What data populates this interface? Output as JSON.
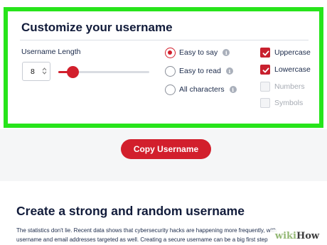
{
  "panel": {
    "title": "Customize your username",
    "length_label": "Username Length",
    "length_value": "8",
    "slider_level": 0.16
  },
  "radio_options": [
    {
      "label": "Easy to say",
      "checked": true
    },
    {
      "label": "Easy to read",
      "checked": false
    },
    {
      "label": "All characters",
      "checked": false
    }
  ],
  "checkbox_options": [
    {
      "label": "Uppercase",
      "checked": true,
      "enabled": true
    },
    {
      "label": "Lowercase",
      "checked": true,
      "enabled": true
    },
    {
      "label": "Numbers",
      "checked": false,
      "enabled": false
    },
    {
      "label": "Symbols",
      "checked": false,
      "enabled": false
    }
  ],
  "info_glyph": "i",
  "copy_button": "Copy Username",
  "section": {
    "heading": "Create a strong and random username",
    "body": "The statistics don't lie. Recent data shows that cybersecurity hacks are happening more frequently, with username and email addresses targeted as well. Creating a secure username can be a big first step"
  },
  "watermark": {
    "wiki": "wiki",
    "how": "How"
  },
  "colors": {
    "accent": "#d21f2c",
    "highlight": "#27e41b",
    "text": "#1b2a4a"
  }
}
